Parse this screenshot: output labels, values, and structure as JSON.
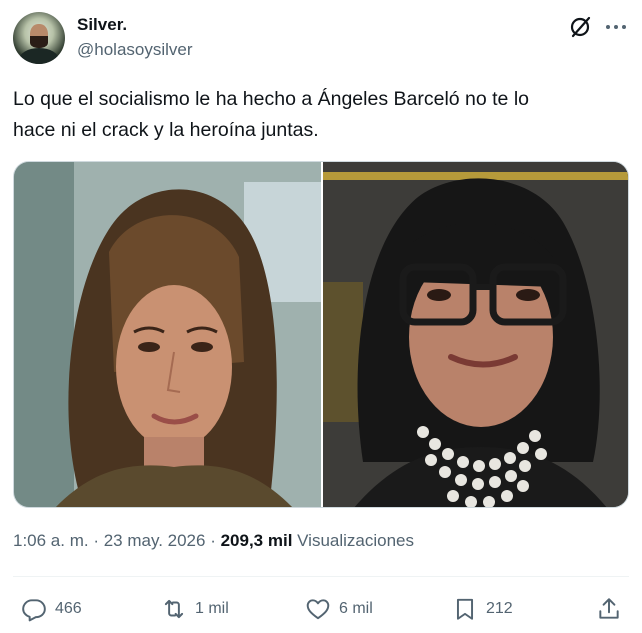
{
  "author": {
    "display_name": "Silver.",
    "handle": "@holasoysilver",
    "avatar_icon": "user-avatar"
  },
  "header_icons": {
    "grok": "grok-icon",
    "more": "more-icon"
  },
  "tweet": {
    "text_line1": "Lo que el socialismo le ha hecho a Ángeles Barceló no te lo",
    "text_line2": "hace ni el crack y la heroína juntas."
  },
  "media": {
    "count": 2,
    "left_photo": "photo-woman-long-hair",
    "right_photo": "photo-woman-glasses-pearls"
  },
  "meta": {
    "time": "1:06 a. m.",
    "separator1": " · ",
    "date": "23 may. 2026",
    "separator2": " · ",
    "views_count": "209,3 mil",
    "views_label": " Visualizaciones"
  },
  "actions": {
    "replies": "466",
    "reposts": "1 mil",
    "likes": "6 mil",
    "bookmarks": "212"
  },
  "colors": {
    "text": "#0f1419",
    "secondary": "#536471",
    "border": "#cfd9de"
  }
}
